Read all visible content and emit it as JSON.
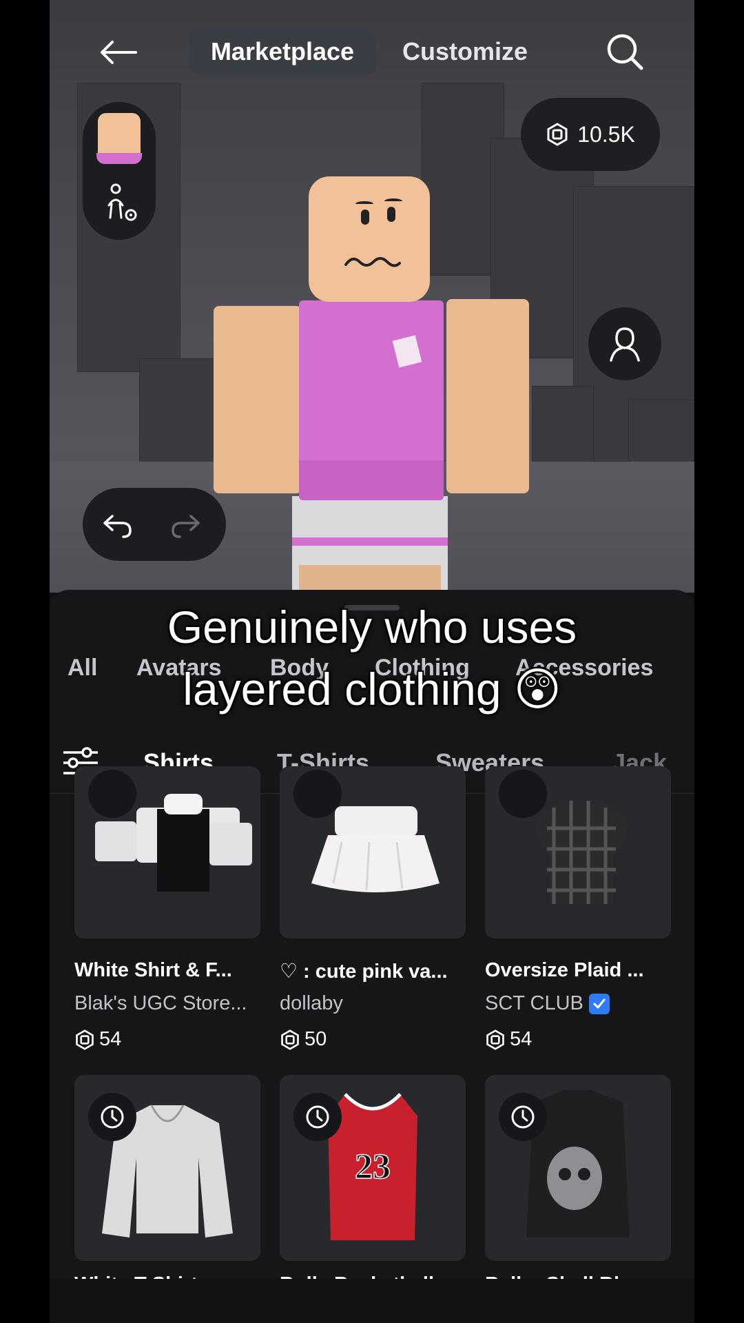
{
  "header": {
    "tabs": [
      {
        "label": "Marketplace",
        "active": true
      },
      {
        "label": "Customize",
        "active": false
      }
    ]
  },
  "robux_balance": "10.5K",
  "categories": [
    "All",
    "Avatars",
    "Body",
    "Clothing",
    "Accessories"
  ],
  "subcategories": [
    {
      "label": "Shirts",
      "active": true
    },
    {
      "label": "T-Shirts",
      "active": false
    },
    {
      "label": "Sweaters",
      "active": false
    },
    {
      "label": "Jack",
      "active": false
    }
  ],
  "caption": {
    "line1": "Genuinely who uses",
    "line2": "layered clothing 😲"
  },
  "items_row1": [
    {
      "name": "White Shirt & F...",
      "creator": "Blak's UGC Store...",
      "price": "54",
      "verified": false
    },
    {
      "name": "♡ : cute pink va...",
      "creator": "dollaby",
      "price": "50",
      "verified": false
    },
    {
      "name": "Oversize Plaid ...",
      "creator": "SCT CLUB",
      "price": "54",
      "verified": true
    }
  ],
  "items_row2": [
    {
      "name": "White T-Shirt w..."
    },
    {
      "name": "Bulls Basketball ..."
    },
    {
      "name": "Baller Skull Bla..."
    }
  ],
  "colors": {
    "accent_pink": "#d36fcf",
    "skin": "#f1c29a",
    "sheet_bg": "#161619",
    "verified_blue": "#2e7bf6"
  },
  "icons": [
    "back-arrow-icon",
    "search-icon",
    "robux-icon",
    "avatar-settings-icon",
    "profile-icon",
    "undo-icon",
    "redo-icon",
    "filter-icon",
    "clock-icon",
    "verified-icon"
  ]
}
